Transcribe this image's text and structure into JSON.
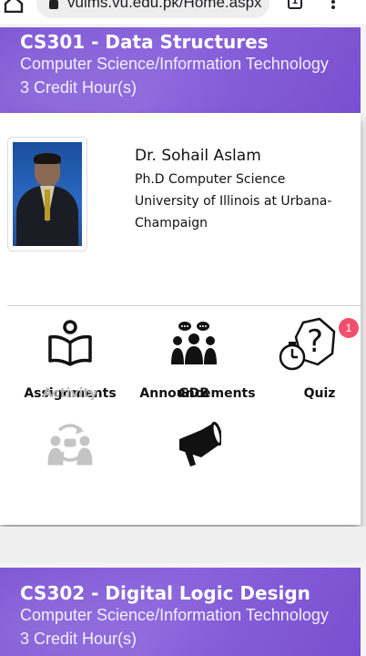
{
  "browser": {
    "url": "vulms.vu.edu.pk/Home.aspx",
    "tab_count": "1"
  },
  "courses": [
    {
      "title": "CS301 - Data Structures",
      "program": "Computer Science/Information Technology",
      "credit": "3 Credit Hour(s)",
      "teacher": {
        "name": "Dr. Sohail Aslam",
        "degree": "Ph.D Computer Science",
        "university_line1": "University of Illinois at Urbana-",
        "university_line2": "Champaign"
      },
      "tiles": [
        {
          "label": "Assignments",
          "icon": "open-book-reader-icon",
          "enabled": true
        },
        {
          "label": "GDB",
          "icon": "group-discussion-icon",
          "enabled": true
        },
        {
          "label": "Quiz",
          "icon": "stopwatch-question-icon",
          "enabled": true,
          "badge": "1"
        },
        {
          "label": "Activity",
          "icon": "activity-exchange-icon",
          "enabled": false
        },
        {
          "label": "Announcements",
          "icon": "megaphone-icon",
          "enabled": true
        }
      ]
    },
    {
      "title": "CS302 - Digital Logic Design",
      "program": "Computer Science/Information Technology",
      "credit": "3 Credit Hour(s)"
    }
  ],
  "colors": {
    "header_purple": "#7d55d4",
    "badge": "#f0506e",
    "disabled_text": "#b9b9b9"
  }
}
